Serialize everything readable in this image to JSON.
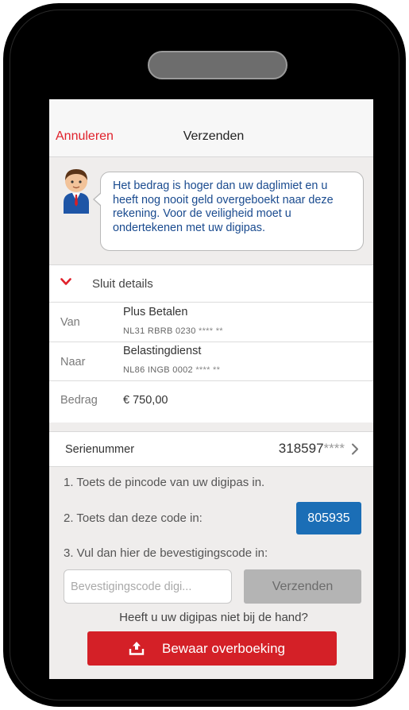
{
  "nav": {
    "cancel_label": "Annuleren",
    "title": "Verzenden"
  },
  "advice": {
    "message": "Het bedrag is hoger dan uw daglimiet en u heeft nog nooit geld overgeboekt naar deze rekening. Voor de veiligheid moet u ondertekenen met uw digipas."
  },
  "details": {
    "toggle_label": "Sluit details",
    "from": {
      "label": "Van",
      "name": "Plus Betalen",
      "account": "NL31 RBRB 0230",
      "masked": "**** **"
    },
    "to": {
      "label": "Naar",
      "name": "Belastingdienst",
      "account": "NL86 INGB 0002",
      "masked": "**** **"
    },
    "amount": {
      "label": "Bedrag",
      "value": "€ 750,00"
    }
  },
  "serial": {
    "label": "Serienummer",
    "value": "318597",
    "masked": "****"
  },
  "steps": {
    "step1": "1. Toets de pincode van uw digipas in.",
    "step2": "2. Toets dan deze code in:",
    "code": "805935",
    "step3": "3. Vul dan hier de bevestigingscode in:"
  },
  "confirm": {
    "placeholder": "Bevestigingscode digi...",
    "send_label": "Verzenden"
  },
  "no_digipas": "Heeft u uw digipas niet bij de hand?",
  "save_button": {
    "label": "Bewaar overboeking",
    "icon": "upload-icon"
  },
  "colors": {
    "accent_red": "#d42027",
    "link_red": "#e0212b",
    "code_blue": "#1b6eb6",
    "message_blue": "#1a4b8f"
  }
}
